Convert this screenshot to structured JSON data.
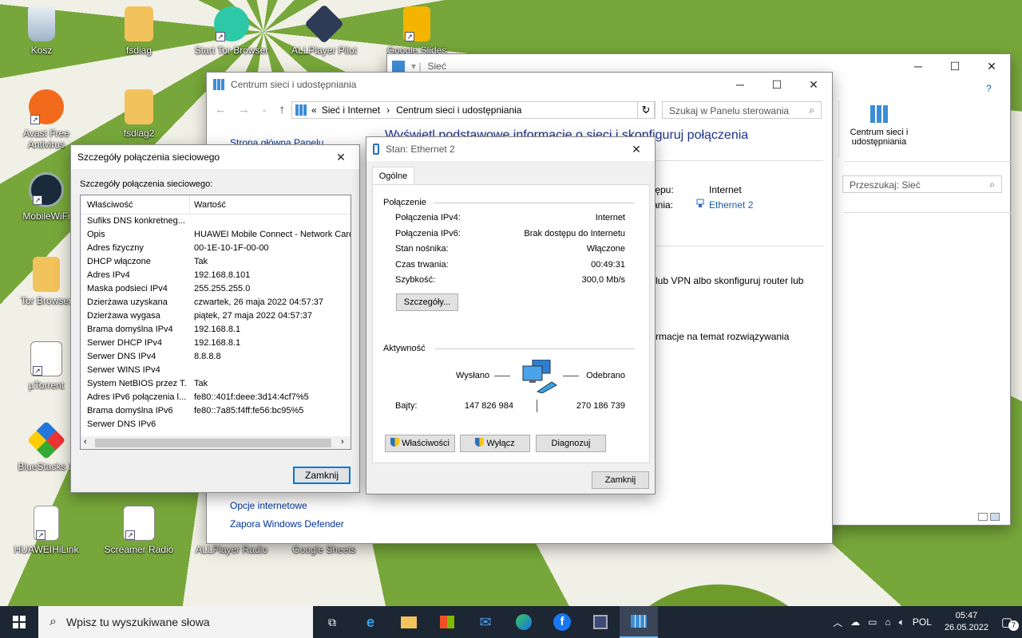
{
  "desktop": {
    "icons": [
      {
        "label": "Kosz"
      },
      {
        "label": "fsdiag"
      },
      {
        "label": "Start Tor Browser"
      },
      {
        "label": "ALLPlayer Pilot"
      },
      {
        "label": "Google Slides"
      },
      {
        "label": "Avast Free Antivirus"
      },
      {
        "label": "fsdiag2"
      },
      {
        "label": "MobileWiFi"
      },
      {
        "label": "Tor Browser"
      },
      {
        "label": "µTorrent"
      },
      {
        "label": "BlueStacks X"
      },
      {
        "label": "HUAWEIHiLink"
      },
      {
        "label": "Screamer Radio"
      },
      {
        "label": "ALLPlayer Radio"
      },
      {
        "label": "Google Sheets"
      }
    ]
  },
  "explorer": {
    "title": "Sieć",
    "ribbon_item": "Centrum sieci i udostępniania",
    "search_placeholder": "Przeszukaj: Sieć"
  },
  "control_panel": {
    "title": "Centrum sieci i udostępniania",
    "breadcrumb": [
      "Sieć i Internet",
      "Centrum sieci i udostępniania"
    ],
    "search_placeholder": "Szukaj w Panelu sterowania",
    "sidebar_top": "Strona główna Panelu",
    "heading": "Wyświetl podstawowe informacje o sieci i skonfiguruj połączenia",
    "access_label": "tępu:",
    "access_value": "Internet",
    "connections_label": "ania:",
    "connections_value": "Ethernet 2",
    "vpn_text": "lub VPN albo skonfiguruj router lub",
    "troubleshoot_text": "rmacje na temat rozwiązywania",
    "sidebar_bottom": [
      "Opcje internetowe",
      "Zapora Windows Defender"
    ]
  },
  "details_dialog": {
    "title": "Szczegóły połączenia sieciowego",
    "subtitle": "Szczegóły połączenia sieciowego:",
    "col_property": "Właściwość",
    "col_value": "Wartość",
    "rows": [
      {
        "p": "Sufiks DNS konkretneg...",
        "v": ""
      },
      {
        "p": "Opis",
        "v": "HUAWEI Mobile Connect - Network Card"
      },
      {
        "p": "Adres fizyczny",
        "v": "00-1E-10-1F-00-00"
      },
      {
        "p": "DHCP włączone",
        "v": "Tak"
      },
      {
        "p": "Adres IPv4",
        "v": "192.168.8.101"
      },
      {
        "p": "Maska podsieci IPv4",
        "v": "255.255.255.0"
      },
      {
        "p": "Dzierżawa uzyskana",
        "v": "czwartek, 26 maja 2022 04:57:37"
      },
      {
        "p": "Dzierżawa wygasa",
        "v": "piątek, 27 maja 2022 04:57:37"
      },
      {
        "p": "Brama domyślna IPv4",
        "v": "192.168.8.1"
      },
      {
        "p": "Serwer DHCP IPv4",
        "v": "192.168.8.1"
      },
      {
        "p": "Serwer DNS IPv4",
        "v": "8.8.8.8"
      },
      {
        "p": "Serwer WINS IPv4",
        "v": ""
      },
      {
        "p": "System NetBIOS przez T...",
        "v": "Tak"
      },
      {
        "p": "Adres IPv6 połączenia l...",
        "v": "fe80::401f:deee:3d14:4cf7%5"
      },
      {
        "p": "Brama domyślna IPv6",
        "v": "fe80::7a85:f4ff:fe56:bc95%5"
      },
      {
        "p": "Serwer DNS IPv6",
        "v": ""
      }
    ],
    "close_label": "Zamknij"
  },
  "status_dialog": {
    "title": "Stan: Ethernet 2",
    "tab": "Ogólne",
    "connection_group": "Połączenie",
    "fields": [
      {
        "k": "Połączenia IPv4:",
        "v": "Internet"
      },
      {
        "k": "Połączenia IPv6:",
        "v": "Brak dostępu do Internetu"
      },
      {
        "k": "Stan nośnika:",
        "v": "Włączone"
      },
      {
        "k": "Czas trwania:",
        "v": "00:49:31"
      },
      {
        "k": "Szybkość:",
        "v": "300,0 Mb/s"
      }
    ],
    "details_button": "Szczegóły...",
    "activity_group": "Aktywność",
    "sent_label": "Wysłano",
    "received_label": "Odebrano",
    "bytes_label": "Bajty:",
    "bytes_sent": "147 826 984",
    "bytes_received": "270 186 739",
    "properties_button": "Właściwości",
    "disable_button": "Wyłącz",
    "diagnose_button": "Diagnozuj",
    "close_button": "Zamknij"
  },
  "taskbar": {
    "search_placeholder": "Wpisz tu wyszukiwane słowa",
    "language": "POL",
    "time": "05:47",
    "date": "26.05.2022",
    "notifications": "7"
  },
  "colors": {
    "accent": "#0078d7",
    "link": "#003399",
    "heading_blue": "#1e3287",
    "taskbar": "#1d2633"
  }
}
